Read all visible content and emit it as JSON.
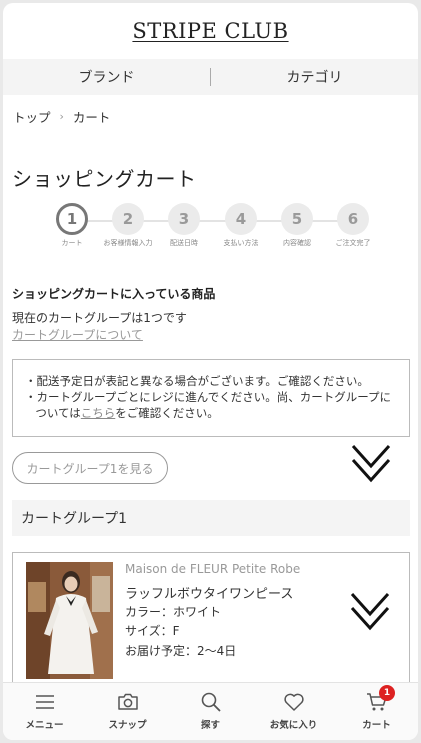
{
  "header": {
    "logo": "STRIPE CLUB"
  },
  "nav": {
    "brand": "ブランド",
    "category": "カテゴリ"
  },
  "breadcrumb": {
    "home": "トップ",
    "separator": "›",
    "current": "カート"
  },
  "page": {
    "title": "ショッピングカート"
  },
  "steps": [
    {
      "num": "1",
      "label": "カート",
      "active": true
    },
    {
      "num": "2",
      "label": "お客様情報入力",
      "active": false
    },
    {
      "num": "3",
      "label": "配送日時",
      "active": false
    },
    {
      "num": "4",
      "label": "支払い方法",
      "active": false
    },
    {
      "num": "5",
      "label": "内容確認",
      "active": false
    },
    {
      "num": "6",
      "label": "ご注文完了",
      "active": false
    }
  ],
  "cart": {
    "heading": "ショッピングカートに入っている商品",
    "group_count": "現在のカートグループは1つです",
    "group_link": "カートグループについて",
    "notice": {
      "line1": "・配送予定日が表記と異なる場合がございます。ご確認ください。",
      "line2_pre": "・カートグループごとにレジに進んでください。尚、カートグループについては",
      "line2_link": "こちら",
      "line2_post": "をご確認ください。"
    },
    "view_button": "カートグループ1を見る",
    "group_title": "カートグループ1"
  },
  "product": {
    "brand": "Maison de FLEUR Petite Robe",
    "name": "ラッフルボウタイワンピース",
    "color": "カラー：ホワイト",
    "size": "サイズ：F",
    "delivery": "お届け予定：2〜4日"
  },
  "tabbar": {
    "menu": "メニュー",
    "snap": "スナップ",
    "search": "探す",
    "favorites": "お気に入り",
    "cart": "カート",
    "cart_badge": "1"
  }
}
